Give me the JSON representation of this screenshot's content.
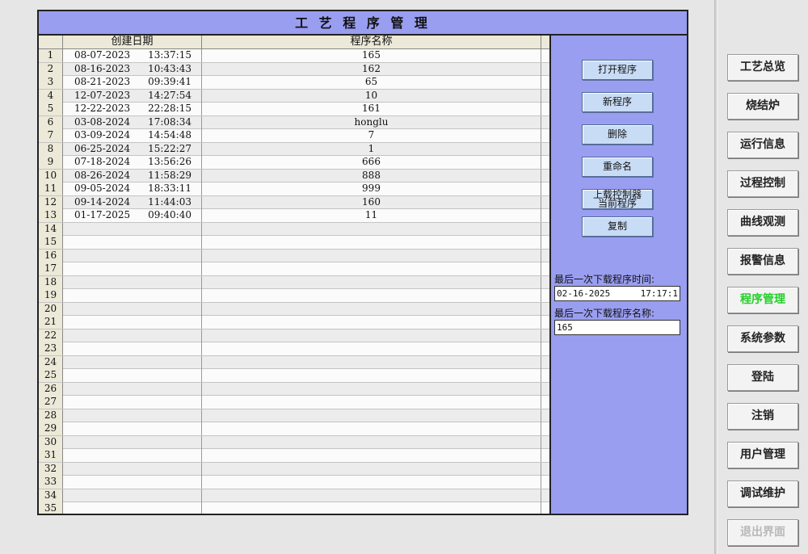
{
  "panel": {
    "title": "工 艺 程 序 管 理"
  },
  "grid": {
    "headers": {
      "date": "创建日期",
      "name": "程序名称"
    },
    "rows": [
      {
        "idx": "1",
        "date": "08-07-2023",
        "time": "13:37:15",
        "name": "165"
      },
      {
        "idx": "2",
        "date": "08-16-2023",
        "time": "10:43:43",
        "name": "162"
      },
      {
        "idx": "3",
        "date": "08-21-2023",
        "time": "09:39:41",
        "name": "65"
      },
      {
        "idx": "4",
        "date": "12-07-2023",
        "time": "14:27:54",
        "name": "10"
      },
      {
        "idx": "5",
        "date": "12-22-2023",
        "time": "22:28:15",
        "name": "161"
      },
      {
        "idx": "6",
        "date": "03-08-2024",
        "time": "17:08:34",
        "name": "honglu"
      },
      {
        "idx": "7",
        "date": "03-09-2024",
        "time": "14:54:48",
        "name": "7"
      },
      {
        "idx": "8",
        "date": "06-25-2024",
        "time": "15:22:27",
        "name": "1"
      },
      {
        "idx": "9",
        "date": "07-18-2024",
        "time": "13:56:26",
        "name": "666"
      },
      {
        "idx": "10",
        "date": "08-26-2024",
        "time": "11:58:29",
        "name": "888"
      },
      {
        "idx": "11",
        "date": "09-05-2024",
        "time": "18:33:11",
        "name": "999"
      },
      {
        "idx": "12",
        "date": "09-14-2024",
        "time": "11:44:03",
        "name": "160"
      },
      {
        "idx": "13",
        "date": "01-17-2025",
        "time": "09:40:40",
        "name": "11"
      },
      {
        "idx": "14",
        "date": "",
        "time": "",
        "name": ""
      },
      {
        "idx": "15",
        "date": "",
        "time": "",
        "name": ""
      },
      {
        "idx": "16",
        "date": "",
        "time": "",
        "name": ""
      },
      {
        "idx": "17",
        "date": "",
        "time": "",
        "name": ""
      },
      {
        "idx": "18",
        "date": "",
        "time": "",
        "name": ""
      },
      {
        "idx": "19",
        "date": "",
        "time": "",
        "name": ""
      },
      {
        "idx": "20",
        "date": "",
        "time": "",
        "name": ""
      },
      {
        "idx": "21",
        "date": "",
        "time": "",
        "name": ""
      },
      {
        "idx": "22",
        "date": "",
        "time": "",
        "name": ""
      },
      {
        "idx": "23",
        "date": "",
        "time": "",
        "name": ""
      },
      {
        "idx": "24",
        "date": "",
        "time": "",
        "name": ""
      },
      {
        "idx": "25",
        "date": "",
        "time": "",
        "name": ""
      },
      {
        "idx": "26",
        "date": "",
        "time": "",
        "name": ""
      },
      {
        "idx": "27",
        "date": "",
        "time": "",
        "name": ""
      },
      {
        "idx": "28",
        "date": "",
        "time": "",
        "name": ""
      },
      {
        "idx": "29",
        "date": "",
        "time": "",
        "name": ""
      },
      {
        "idx": "30",
        "date": "",
        "time": "",
        "name": ""
      },
      {
        "idx": "31",
        "date": "",
        "time": "",
        "name": ""
      },
      {
        "idx": "32",
        "date": "",
        "time": "",
        "name": ""
      },
      {
        "idx": "33",
        "date": "",
        "time": "",
        "name": ""
      },
      {
        "idx": "34",
        "date": "",
        "time": "",
        "name": ""
      },
      {
        "idx": "35",
        "date": "",
        "time": "",
        "name": ""
      }
    ]
  },
  "actions": {
    "open": "打开程序",
    "new": "新程序",
    "delete": "删除",
    "rename": "重命名",
    "upload_line1": "上载控制器",
    "upload_line2": "当前程序",
    "copy": "复制"
  },
  "last_download": {
    "time_label": "最后一次下载程序时间:",
    "date": "02-16-2025",
    "time": "17:17:1",
    "name_label": "最后一次下载程序名称:",
    "name": "165"
  },
  "nav": {
    "items": [
      {
        "label": "工艺总览",
        "state": "normal"
      },
      {
        "label": "烧结炉",
        "state": "normal"
      },
      {
        "label": "运行信息",
        "state": "normal"
      },
      {
        "label": "过程控制",
        "state": "normal"
      },
      {
        "label": "曲线观测",
        "state": "normal"
      },
      {
        "label": "报警信息",
        "state": "normal"
      },
      {
        "label": "程序管理",
        "state": "active"
      },
      {
        "label": "系统参数",
        "state": "normal"
      },
      {
        "label": "登陆",
        "state": "normal"
      },
      {
        "label": "注销",
        "state": "normal"
      },
      {
        "label": "用户管理",
        "state": "normal"
      },
      {
        "label": "调试维护",
        "state": "normal"
      },
      {
        "label": "退出界面",
        "state": "disabled"
      }
    ]
  },
  "colors": {
    "panel_bg": "#9a9ef0",
    "active_nav": "#22d02a",
    "disabled_nav": "#b9b9b9"
  }
}
